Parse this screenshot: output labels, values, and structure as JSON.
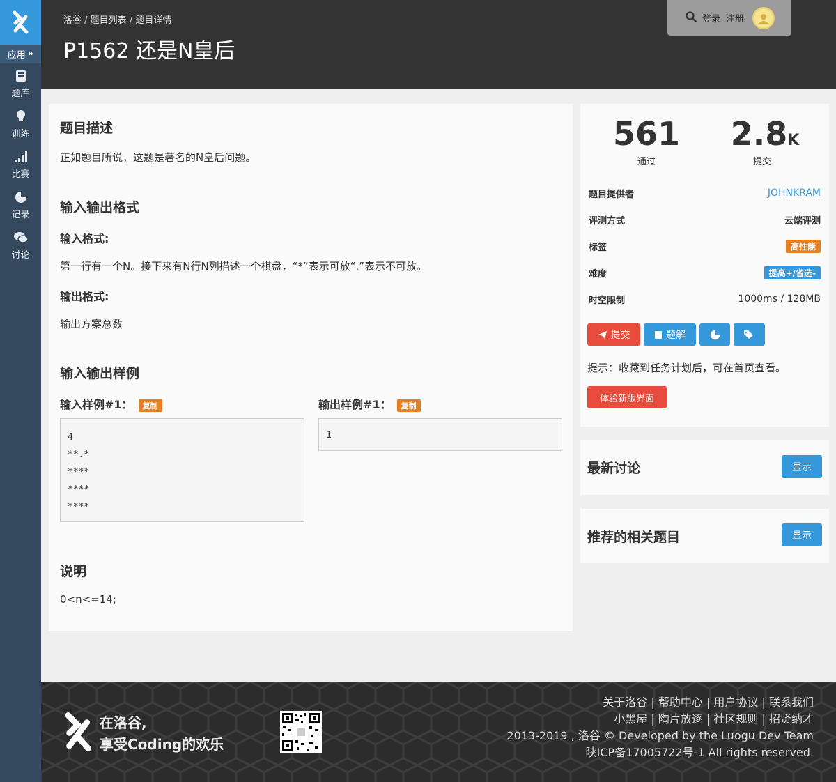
{
  "sidebar": {
    "app_label": "应用",
    "items": [
      {
        "label": "题库",
        "icon": "book-icon"
      },
      {
        "label": "训练",
        "icon": "lightbulb-icon"
      },
      {
        "label": "比赛",
        "icon": "bar-chart-icon"
      },
      {
        "label": "记录",
        "icon": "pie-chart-icon"
      },
      {
        "label": "讨论",
        "icon": "comments-icon"
      }
    ]
  },
  "header": {
    "breadcrumb": [
      "洛谷",
      "题目列表",
      "题目详情"
    ],
    "title": "P1562 还是N皇后",
    "login": "登录",
    "register": "注册"
  },
  "problem": {
    "desc_heading": "题目描述",
    "desc_text": "正如题目所说，这题是著名的N皇后问题。",
    "io_heading": "输入输出格式",
    "input_format_label": "输入格式:",
    "input_format_text": "第一行有一个N。接下来有N行N列描述一个棋盘，“*”表示可放“.”表示不可放。",
    "output_format_label": "输出格式:",
    "output_format_text": "输出方案总数",
    "samples_heading": "输入输出样例",
    "sample_input_label": "输入样例#1：",
    "sample_output_label": "输出样例#1：",
    "copy_label": "复制",
    "sample_input": "4\n**.*\n****\n****\n****",
    "sample_output": "1",
    "note_heading": "说明",
    "note_text": "0<n<=14;"
  },
  "stats": {
    "passed": "561",
    "passed_label": "通过",
    "submitted": "2.8",
    "submitted_unit": "K",
    "submitted_label": "提交",
    "rows": [
      {
        "key": "题目提供者",
        "value": "JOHNKRAM"
      },
      {
        "key": "评测方式",
        "value": "云端评测"
      },
      {
        "key": "标签",
        "value": "高性能"
      },
      {
        "key": "难度",
        "value": "提高+/省选-"
      },
      {
        "key": "时空限制",
        "value": "1000ms / 128MB"
      }
    ],
    "submit_btn": "提交",
    "solution_btn": "题解",
    "hint": "提示：收藏到任务计划后，可在首页查看。",
    "new_ui_btn": "体验新版界面"
  },
  "discussion": {
    "title": "最新讨论",
    "show": "显示"
  },
  "related": {
    "title": "推荐的相关题目",
    "show": "显示"
  },
  "footer": {
    "slogan_1": "在洛谷,",
    "slogan_2": "享受Coding的欢乐",
    "links_1": "关于洛谷 | 帮助中心 | 用户协议 | 联系我们",
    "links_2": "小黑屋 | 陶片放逐 | 社区规则 | 招贤纳才",
    "copyright": "2013-2019 , 洛谷 © Developed by the Luogu Dev Team",
    "icp": "陕ICP备17005722号-1 All rights reserved."
  },
  "colors": {
    "brand_blue": "#3498db",
    "sidebar_bg": "#34495e",
    "header_bg": "#333333",
    "danger_red": "#e74c3c",
    "tag_orange": "#e67e22",
    "link_blue": "#3498db"
  }
}
